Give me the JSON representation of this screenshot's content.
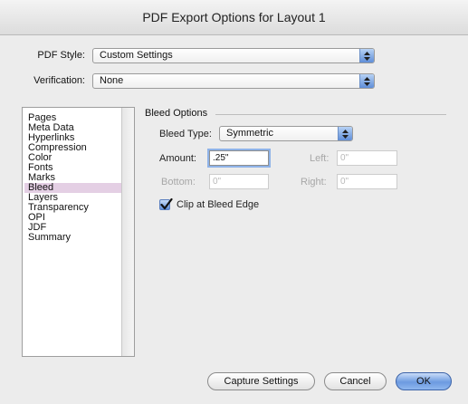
{
  "window": {
    "title": "PDF Export Options for Layout 1"
  },
  "pdf_style": {
    "label": "PDF Style:",
    "value": "Custom Settings"
  },
  "verification": {
    "label": "Verification:",
    "value": "None"
  },
  "categories": [
    "Pages",
    "Meta Data",
    "Hyperlinks",
    "Compression",
    "Color",
    "Fonts",
    "Marks",
    "Bleed",
    "Layers",
    "Transparency",
    "OPI",
    "JDF",
    "Summary"
  ],
  "selected_category": "Bleed",
  "bleed": {
    "group_title": "Bleed Options",
    "type_label": "Bleed Type:",
    "type_value": "Symmetric",
    "amount_label": "Amount:",
    "amount_value": ".25\"",
    "left_label": "Left:",
    "left_value": "0\"",
    "bottom_label": "Bottom:",
    "bottom_value": "0\"",
    "right_label": "Right:",
    "right_value": "0\"",
    "clip_label": "Clip at Bleed Edge",
    "clip_checked": true
  },
  "buttons": {
    "capture": "Capture Settings",
    "cancel": "Cancel",
    "ok": "OK"
  },
  "colors": {
    "accent": "#5f8ed8",
    "selection": "#e4cfe4"
  }
}
